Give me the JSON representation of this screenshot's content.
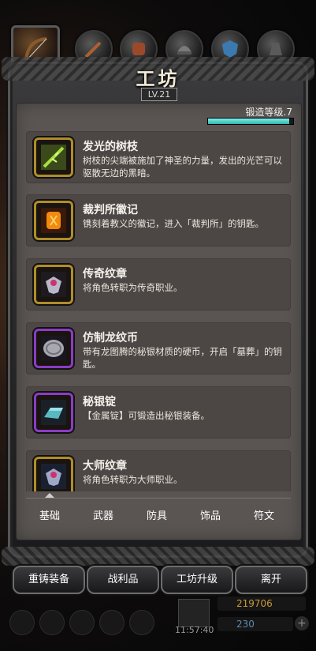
{
  "window": {
    "title": "工坊",
    "level": "LV.21"
  },
  "smithing": {
    "label": "锻造等级.7",
    "progress": 0.95
  },
  "categories": [
    {
      "icon": "bow-icon",
      "selected": true
    },
    {
      "icon": "sword-icon"
    },
    {
      "icon": "armor-icon"
    },
    {
      "icon": "helmet-icon"
    },
    {
      "icon": "shield-icon"
    },
    {
      "icon": "gloves-icon"
    }
  ],
  "items": [
    {
      "name": "发光的树枝",
      "desc": "树枝的尖端被施加了神圣的力量，发出的光芒可以驱散无边的黑暗。",
      "icon": "glowing-branch-icon",
      "frame": "gold"
    },
    {
      "name": "裁判所徽记",
      "desc": "镌刻着教义的徽记，进入「裁判所」的钥匙。",
      "icon": "tribunal-emblem-icon",
      "frame": "gold"
    },
    {
      "name": "传奇纹章",
      "desc": "将角色转职为传奇职业。",
      "icon": "legend-crest-icon",
      "frame": "gold"
    },
    {
      "name": "仿制龙纹币",
      "desc": "带有龙图腾的秘银材质的硬币，开启「墓葬」的钥匙。",
      "icon": "dragon-coin-icon",
      "frame": "purple"
    },
    {
      "name": "秘银锭",
      "desc": "【金属锭】可锻造出秘银装备。",
      "icon": "mithril-ingot-icon",
      "frame": "purple"
    },
    {
      "name": "大师纹章",
      "desc": "将角色转职为大师职业。",
      "icon": "master-crest-icon",
      "frame": "gold"
    }
  ],
  "tabs": [
    "基础",
    "武器",
    "防具",
    "饰品",
    "符文"
  ],
  "buttons": {
    "recast": "重铸装备",
    "loot": "战利品",
    "upgrade": "工坊升级",
    "leave": "离开"
  },
  "hud": {
    "time": "11:57:40",
    "gold": "219706",
    "gems": "230"
  },
  "colors": {
    "xp": "#3fd0c8",
    "gold_frame": "#b08d2a",
    "purple_frame": "#8a3cc4"
  }
}
